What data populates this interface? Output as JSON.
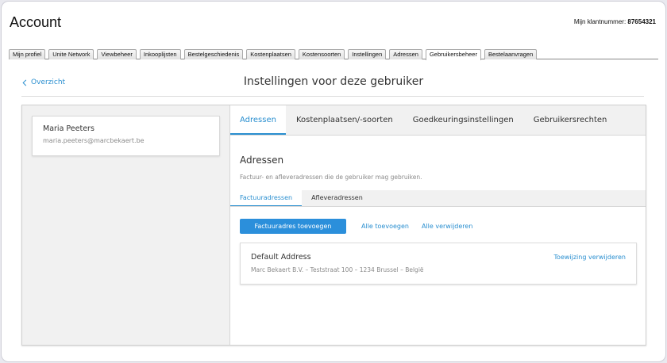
{
  "header": {
    "title": "Account",
    "customer_number_label": "Mijn klantnummer:",
    "customer_number": "87654321"
  },
  "top_tabs": [
    "Mijn profiel",
    "Unite Network",
    "Viewbeheer",
    "Inkooplijsten",
    "Bestelgeschiedenis",
    "Kostenplaatsen",
    "Kostensoorten",
    "Instellingen",
    "Adressen",
    "Gebruikersbeheer",
    "Bestelaanvragen"
  ],
  "top_tabs_active": "Gebruikersbeheer",
  "breadcrumb": {
    "label": "Overzicht"
  },
  "page_title": "Instellingen voor deze gebruiker",
  "user": {
    "name": "Maria Peeters",
    "email": "maria.peeters@marcbekaert.be"
  },
  "sub_tabs": [
    "Adressen",
    "Kostenplaatsen/-soorten",
    "Goedkeuringsinstellingen",
    "Gebruikersrechten"
  ],
  "sub_tabs_active": "Adressen",
  "section": {
    "title": "Adressen",
    "description": "Factuur- en afleveradressen die de gebruiker mag gebruiken."
  },
  "address_tabs": [
    "Factuuradressen",
    "Afleveradressen"
  ],
  "address_tabs_active": "Factuuradressen",
  "actions": {
    "add_button": "Factuuradres toevoegen",
    "add_all": "Alle toevoegen",
    "remove_all": "Alle verwijderen"
  },
  "addresses": [
    {
      "name": "Default Address",
      "line": "Marc Bekaert B.V. – Teststraat 100 – 1234 Brussel – België",
      "remove_label": "Toewijzing verwijderen"
    }
  ],
  "colors": {
    "accent": "#2a8fd0",
    "button": "#2b8fdb",
    "panel_gray": "#f1f1f1"
  }
}
